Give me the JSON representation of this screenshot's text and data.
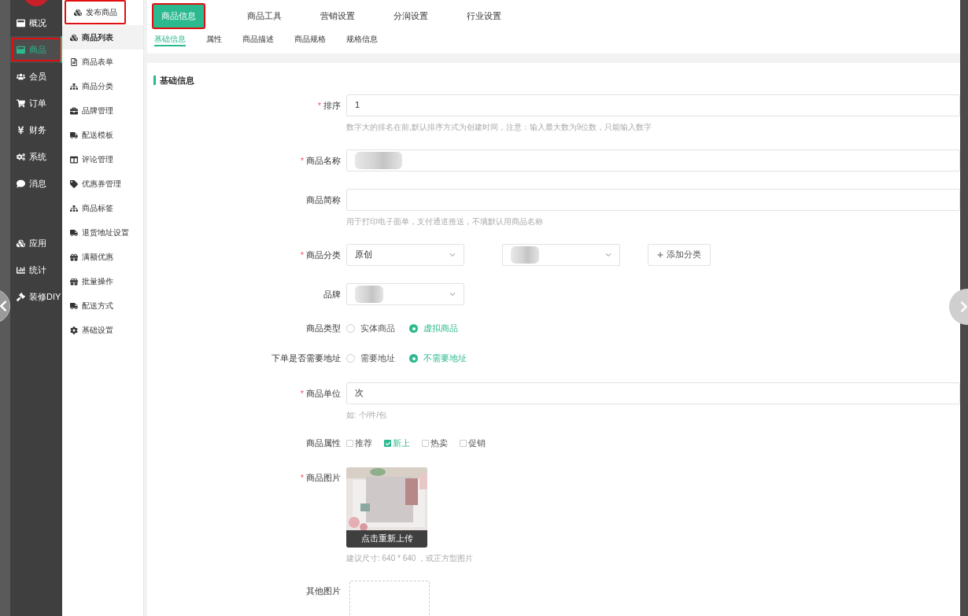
{
  "sidebar": {
    "items": [
      {
        "label": "概况",
        "selected": false,
        "highlighted": false
      },
      {
        "label": "商品",
        "selected": true,
        "highlighted": true
      },
      {
        "label": "会员",
        "selected": false,
        "highlighted": false
      },
      {
        "label": "订单",
        "selected": false,
        "highlighted": false
      },
      {
        "label": "财务",
        "selected": false,
        "highlighted": false
      },
      {
        "label": "系统",
        "selected": false,
        "highlighted": false
      },
      {
        "label": "消息",
        "selected": false,
        "highlighted": false
      }
    ],
    "bottom_items": [
      {
        "label": "应用",
        "selected": false,
        "highlighted": false
      },
      {
        "label": "统计",
        "selected": false,
        "highlighted": false
      },
      {
        "label": "装修DIY",
        "selected": false,
        "highlighted": false
      }
    ]
  },
  "submenu": {
    "items": [
      {
        "label": "发布商品",
        "selected": false,
        "highlighted": true
      },
      {
        "label": "商品列表",
        "selected": true,
        "highlighted": false
      },
      {
        "label": "商品表单",
        "selected": false,
        "highlighted": false
      },
      {
        "label": "商品分类",
        "selected": false,
        "highlighted": false
      },
      {
        "label": "品牌管理",
        "selected": false,
        "highlighted": false
      },
      {
        "label": "配送模板",
        "selected": false,
        "highlighted": false
      },
      {
        "label": "评论管理",
        "selected": false,
        "highlighted": false
      },
      {
        "label": "优惠券管理",
        "selected": false,
        "highlighted": false
      },
      {
        "label": "商品标签",
        "selected": false,
        "highlighted": false
      },
      {
        "label": "退货地址设置",
        "selected": false,
        "highlighted": false
      },
      {
        "label": "满额优惠",
        "selected": false,
        "highlighted": false
      },
      {
        "label": "批量操作",
        "selected": false,
        "highlighted": false
      },
      {
        "label": "配送方式",
        "selected": false,
        "highlighted": false
      },
      {
        "label": "基础设置",
        "selected": false,
        "highlighted": false
      }
    ]
  },
  "tabs": [
    {
      "label": "商品信息",
      "selected": true,
      "highlighted": true
    },
    {
      "label": "商品工具",
      "selected": false,
      "highlighted": false
    },
    {
      "label": "营销设置",
      "selected": false,
      "highlighted": false
    },
    {
      "label": "分润设置",
      "selected": false,
      "highlighted": false
    },
    {
      "label": "行业设置",
      "selected": false,
      "highlighted": false
    }
  ],
  "subtabs": [
    {
      "label": "基础信息",
      "selected": true
    },
    {
      "label": "属性",
      "selected": false
    },
    {
      "label": "商品描述",
      "selected": false
    },
    {
      "label": "商品规格",
      "selected": false
    },
    {
      "label": "规格信息",
      "selected": false
    }
  ],
  "section_title": "基础信息",
  "fields": [
    {
      "kind": "text",
      "label": "排序",
      "marker": "*",
      "value": "1",
      "help": "数字大的排名在前,默认排序方式为创建时间，注意：输入最大数为9位数，只能输入数字"
    },
    {
      "kind": "text",
      "label": "商品名称",
      "marker": "*",
      "redacted": true
    },
    {
      "kind": "text",
      "label": "商品简称",
      "help": "用于打印电子面单，支付通道推送，不填默认用商品名称"
    },
    {
      "kind": "category",
      "label": "商品分类",
      "marker": "*",
      "selects": [
        {
          "value": "原创"
        },
        {
          "redacted": true
        }
      ],
      "button": "添加分类"
    },
    {
      "kind": "select",
      "label": "品牌",
      "selects": [
        {
          "redacted": true
        }
      ]
    },
    {
      "kind": "radio",
      "label": "商品类型",
      "options": [
        {
          "label": "实体商品",
          "selected": false
        },
        {
          "label": "虚拟商品",
          "selected": true
        }
      ]
    },
    {
      "kind": "radio",
      "label": "下单是否需要地址",
      "options": [
        {
          "label": "需要地址",
          "selected": false
        },
        {
          "label": "不需要地址",
          "selected": true
        }
      ]
    },
    {
      "kind": "text",
      "label": "商品单位",
      "marker": "*",
      "value": "次",
      "help": "如: 个/件/包"
    },
    {
      "kind": "checkbox",
      "label": "商品属性",
      "options": [
        {
          "label": "推荐",
          "checked": false
        },
        {
          "label": "新上",
          "checked": true
        },
        {
          "label": "热卖",
          "checked": false
        },
        {
          "label": "促销",
          "checked": false
        }
      ]
    },
    {
      "label": "商品图片",
      "marker": "*",
      "overlay": "点击重新上传",
      "help": "建议尺寸: 640 * 640 ，或正方型图片"
    },
    {
      "kind": "upload",
      "label": "其他图片"
    }
  ]
}
